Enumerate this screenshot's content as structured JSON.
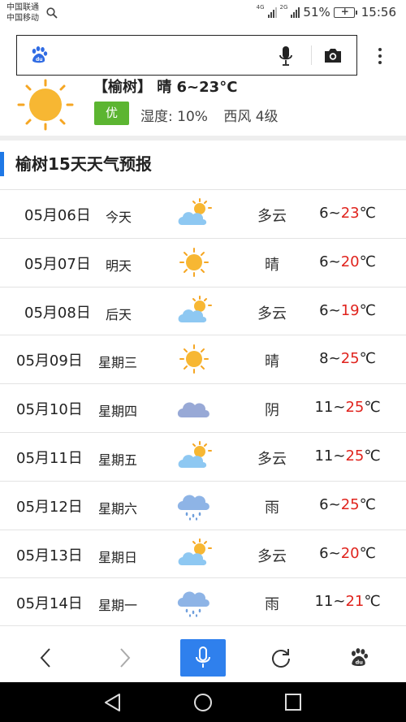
{
  "status_bar": {
    "carrier_1": "中国联通",
    "carrier_2": "中国移动",
    "net_1": "4G",
    "net_2": "2G",
    "battery": "51%",
    "time": "15:56"
  },
  "search": {
    "query": "",
    "icons": [
      "baidu-paw-icon",
      "mic-icon",
      "camera-icon",
      "more-vertical-icon"
    ]
  },
  "current": {
    "title": "【榆树】 晴 6~23°C",
    "badge": "优",
    "badge_color": "#5cb531",
    "humidity": "湿度: 10%",
    "wind": "西风 4级",
    "icon": "sun-icon"
  },
  "forecast": {
    "title": "榆树15天天气预报",
    "accent_color": "#1e78e6",
    "high_color": "#e0231d",
    "rows": [
      {
        "date": "05月06日",
        "day": "今天",
        "icon": "partly-cloudy",
        "cond": "多云",
        "low": "6~",
        "high": "23",
        "unit": "℃"
      },
      {
        "date": "05月07日",
        "day": "明天",
        "icon": "sunny",
        "cond": "晴",
        "low": "6~",
        "high": "20",
        "unit": "℃"
      },
      {
        "date": "05月08日",
        "day": "后天",
        "icon": "partly-cloudy",
        "cond": "多云",
        "low": "6~",
        "high": "19",
        "unit": "℃"
      },
      {
        "date": "05月09日",
        "day": "星期三",
        "icon": "sunny",
        "cond": "晴",
        "low": "8~",
        "high": "25",
        "unit": "℃"
      },
      {
        "date": "05月10日",
        "day": "星期四",
        "icon": "overcast",
        "cond": "阴",
        "low": "11~",
        "high": "25",
        "unit": "℃"
      },
      {
        "date": "05月11日",
        "day": "星期五",
        "icon": "partly-cloudy",
        "cond": "多云",
        "low": "11~",
        "high": "25",
        "unit": "℃"
      },
      {
        "date": "05月12日",
        "day": "星期六",
        "icon": "rain",
        "cond": "雨",
        "low": "6~",
        "high": "25",
        "unit": "℃"
      },
      {
        "date": "05月13日",
        "day": "星期日",
        "icon": "partly-cloudy",
        "cond": "多云",
        "low": "6~",
        "high": "20",
        "unit": "℃"
      },
      {
        "date": "05月14日",
        "day": "星期一",
        "icon": "rain",
        "cond": "雨",
        "low": "11~",
        "high": "21",
        "unit": "℃"
      }
    ]
  },
  "toolbar": {
    "buttons": [
      "back-icon",
      "forward-icon",
      "voice-icon",
      "refresh-icon",
      "baidu-home-icon"
    ],
    "accent": "#2f80ed"
  },
  "navbar": {
    "buttons": [
      "nav-back-icon",
      "nav-home-icon",
      "nav-recents-icon"
    ]
  }
}
